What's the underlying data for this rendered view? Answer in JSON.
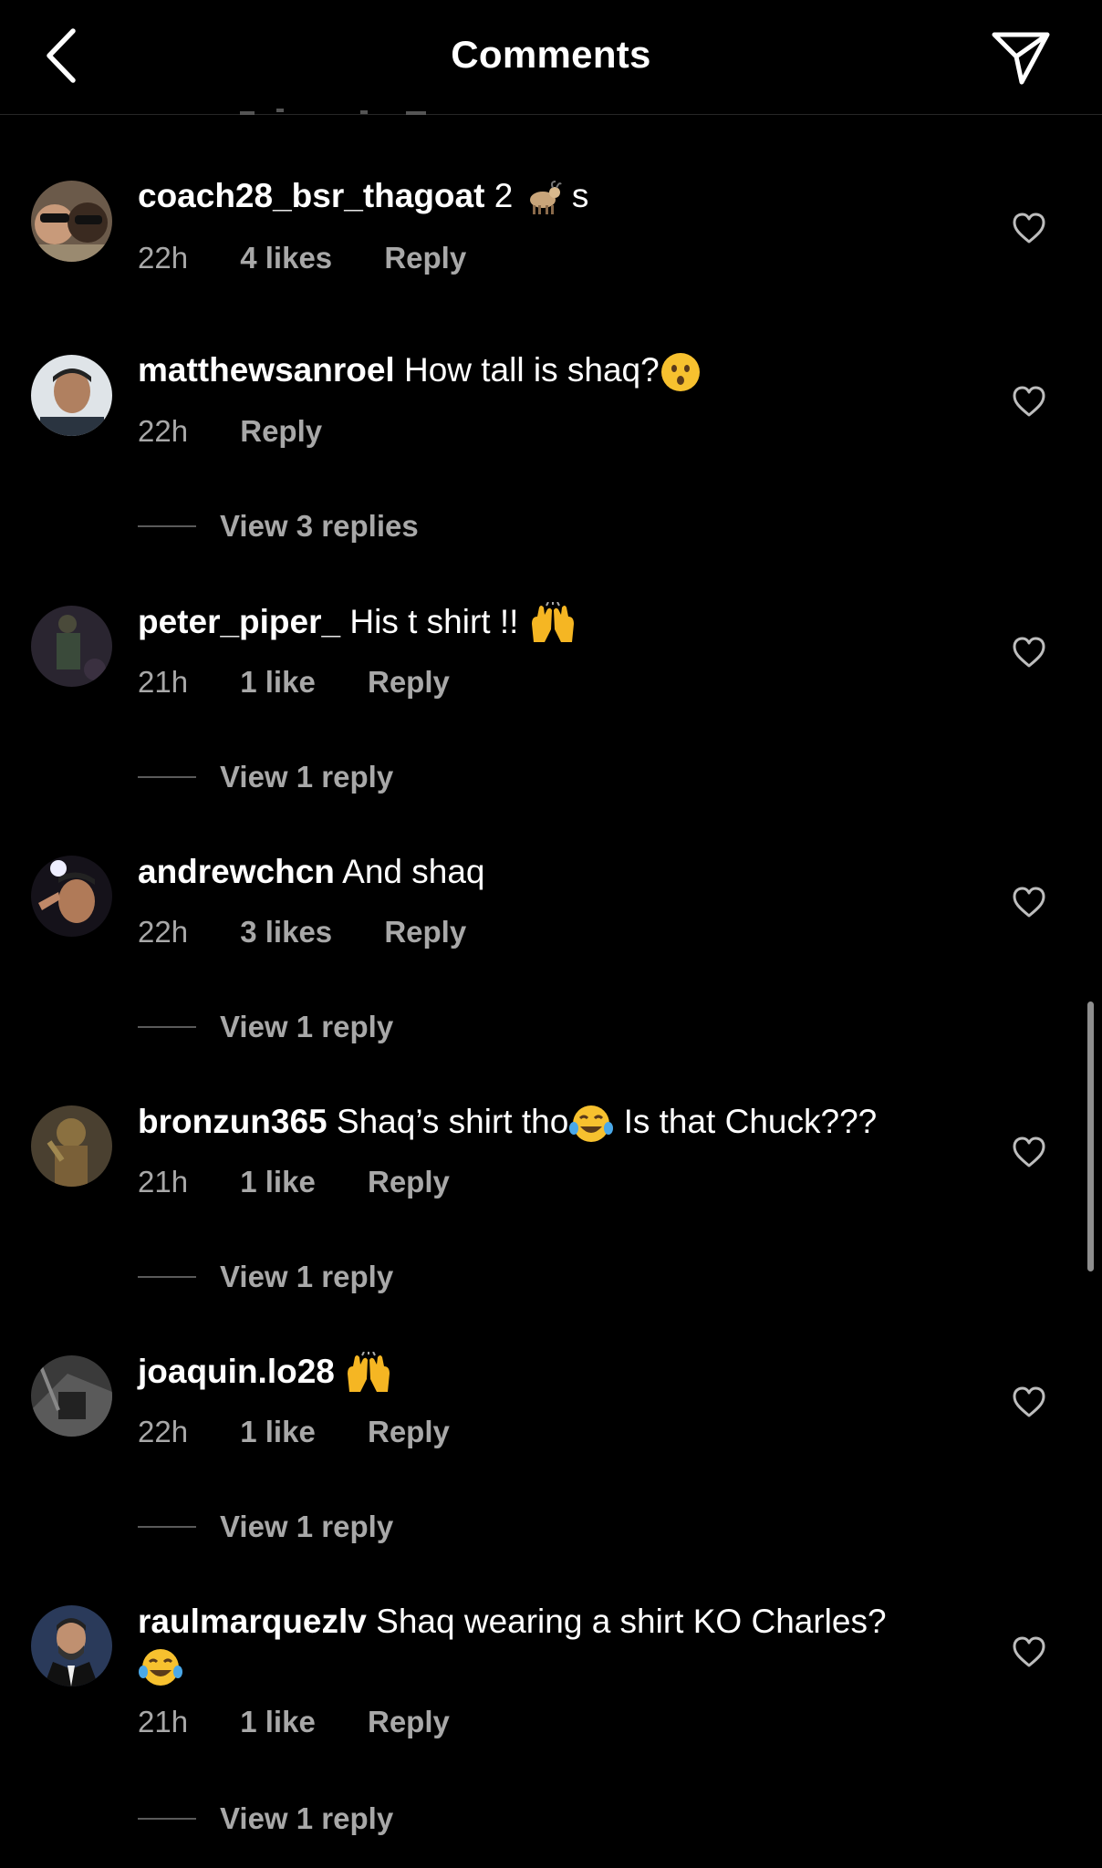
{
  "header": {
    "title": "Comments",
    "back_icon": "chevron-left-icon",
    "send_icon": "paper-plane-icon"
  },
  "comments": [
    {
      "username": "coach28_bsr_thagoat",
      "text": "2",
      "emoji": "goat",
      "text_after": "s",
      "time": "22h",
      "likes": "4 likes",
      "reply": "Reply"
    },
    {
      "username": "matthewsanroel",
      "text": "How tall is shaq?",
      "emoji": "hushed-face",
      "time": "22h",
      "reply": "Reply",
      "view_replies": "View 3 replies"
    },
    {
      "username": "peter_piper_",
      "text": "His t shirt !!",
      "emoji": "raising-hands",
      "time": "21h",
      "likes": "1 like",
      "reply": "Reply",
      "view_replies": "View 1 reply"
    },
    {
      "username": "andrewchcn",
      "text": "And shaq",
      "time": "22h",
      "likes": "3 likes",
      "reply": "Reply",
      "view_replies": "View 1 reply"
    },
    {
      "username": "bronzun365",
      "text": "Shaq’s shirt tho",
      "emoji": "tears-of-joy",
      "text_after": "Is that Chuck???",
      "time": "21h",
      "likes": "1 like",
      "reply": "Reply",
      "view_replies": "View 1 reply"
    },
    {
      "username": "joaquin.lo28",
      "text": "",
      "emoji": "raising-hands",
      "time": "22h",
      "likes": "1 like",
      "reply": "Reply",
      "view_replies": "View 1 reply"
    },
    {
      "username": "raulmarquezlv",
      "text": "Shaq wearing a shirt KO Charles?",
      "emoji": "tears-of-joy",
      "time": "21h",
      "likes": "1 like",
      "reply": "Reply",
      "view_replies": "View 1 reply"
    }
  ],
  "colors": {
    "background": "#000000",
    "text": "#ffffff",
    "meta": "#a8a8a8"
  }
}
